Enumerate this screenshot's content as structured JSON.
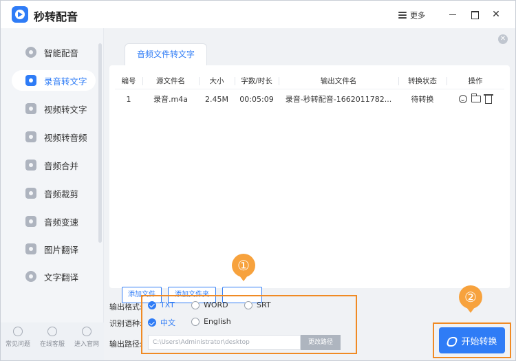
{
  "app": {
    "title": "秒转配音",
    "more_label": "更多"
  },
  "sidebar": {
    "items": [
      {
        "label": "智能配音",
        "active": false
      },
      {
        "label": "录音转文字",
        "active": true
      },
      {
        "label": "视频转文字",
        "active": false
      },
      {
        "label": "视频转音频",
        "active": false
      },
      {
        "label": "音频合并",
        "active": false
      },
      {
        "label": "音频裁剪",
        "active": false
      },
      {
        "label": "音频变速",
        "active": false
      },
      {
        "label": "图片翻译",
        "active": false
      },
      {
        "label": "文字翻译",
        "active": false
      }
    ],
    "bottom": [
      {
        "label": "常见问题",
        "icon": "question-icon"
      },
      {
        "label": "在线客服",
        "icon": "headset-icon"
      },
      {
        "label": "进入官网",
        "icon": "home-icon"
      }
    ]
  },
  "main": {
    "tab_label": "音频文件转文字",
    "table": {
      "headers": [
        "编号",
        "源文件名",
        "大小",
        "字数/时长",
        "输出文件名",
        "转换状态",
        "操作"
      ],
      "rows": [
        {
          "no": "1",
          "source": "录音.m4a",
          "size": "2.45M",
          "duration": "00:05:09",
          "output": "录音-秒转配音-1662011782...",
          "status": "待转换"
        }
      ]
    },
    "buttons": {
      "add_file": "添加文件",
      "add_folder": "添加文件夹"
    },
    "options": {
      "format_label": "输出格式:",
      "formats": [
        {
          "label": "TXT",
          "checked": true
        },
        {
          "label": "WORD",
          "checked": false
        },
        {
          "label": "SRT",
          "checked": false
        }
      ],
      "language_label": "识别语种:",
      "languages": [
        {
          "label": "中文",
          "checked": true
        },
        {
          "label": "English",
          "checked": false
        }
      ],
      "path_label": "输出路径:",
      "path_value": "C:\\Users\\Administrator\\desktop",
      "change_path": "更改路径"
    },
    "start_button": "开始转换"
  },
  "markers": {
    "m1": "①",
    "m2": "②"
  },
  "colors": {
    "accent": "#2f7cf6",
    "highlight": "#f08a24",
    "marker": "#f7a23d"
  }
}
